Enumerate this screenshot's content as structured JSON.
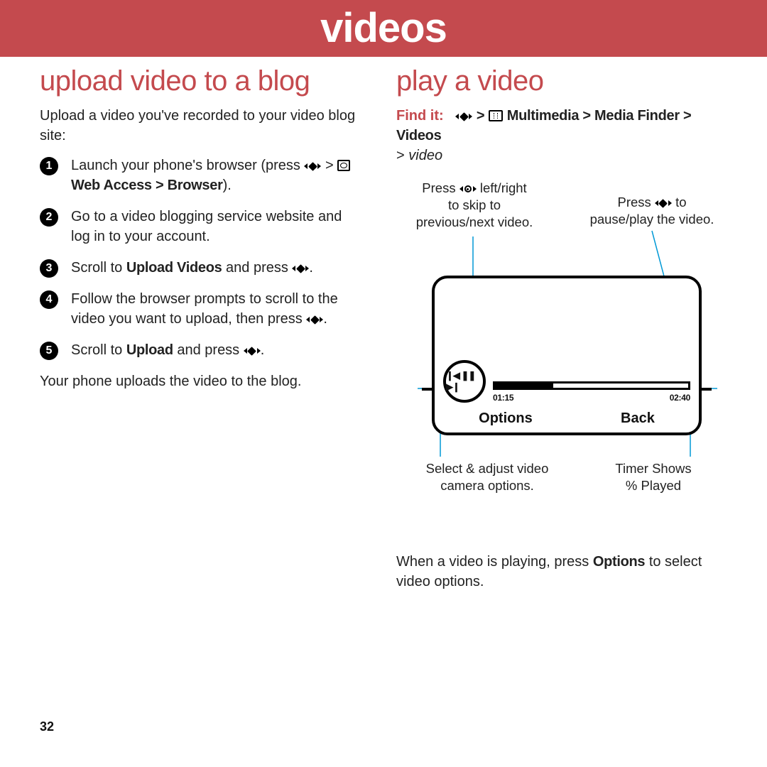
{
  "banner": {
    "title": "videos"
  },
  "left": {
    "heading": "upload video to a blog",
    "intro": "Upload a video you've recorded to your video blog site:",
    "steps": {
      "s1a": "Launch your phone's browser (press ",
      "s1b": " > ",
      "s1c": " Web Access > Browser",
      "s1d": ").",
      "s2": "Go to a video blogging service website and log in to your account.",
      "s3a": "Scroll to ",
      "s3b": "Upload Videos",
      "s3c": " and press ",
      "s3d": ".",
      "s4a": "Follow the browser prompts to scroll to the video you want to upload, then press ",
      "s4b": ".",
      "s5a": "Scroll to ",
      "s5b": "Upload",
      "s5c": " and press ",
      "s5d": "."
    },
    "after": "Your phone uploads the video to the blog."
  },
  "right": {
    "heading": "play a video",
    "findit_label": "Find it:",
    "findit_path_a": " > ",
    "findit_path_b": " Multimedia > Media Finder > Videos",
    "findit_line2a": "> ",
    "findit_line2b": "video",
    "callouts": {
      "skip_a": "Press ",
      "skip_b": " left/right",
      "skip_c": "to skip to",
      "skip_d": "previous/next video.",
      "pause_a": "Press ",
      "pause_b": " to",
      "pause_c": "pause/play the video.",
      "options_a": "Select & adjust video",
      "options_b": "camera options.",
      "timer_a": "Timer Shows",
      "timer_b": "% Played"
    },
    "phone": {
      "knob_glyphs": "❙◀ ❚❚ ▶❙",
      "time_current": "01:15",
      "time_total": "02:40",
      "soft_left": "Options",
      "soft_right": "Back"
    },
    "after": "When a video is playing, press ",
    "after_bold": "Options",
    "after2": " to select video options."
  },
  "page_number": "32"
}
